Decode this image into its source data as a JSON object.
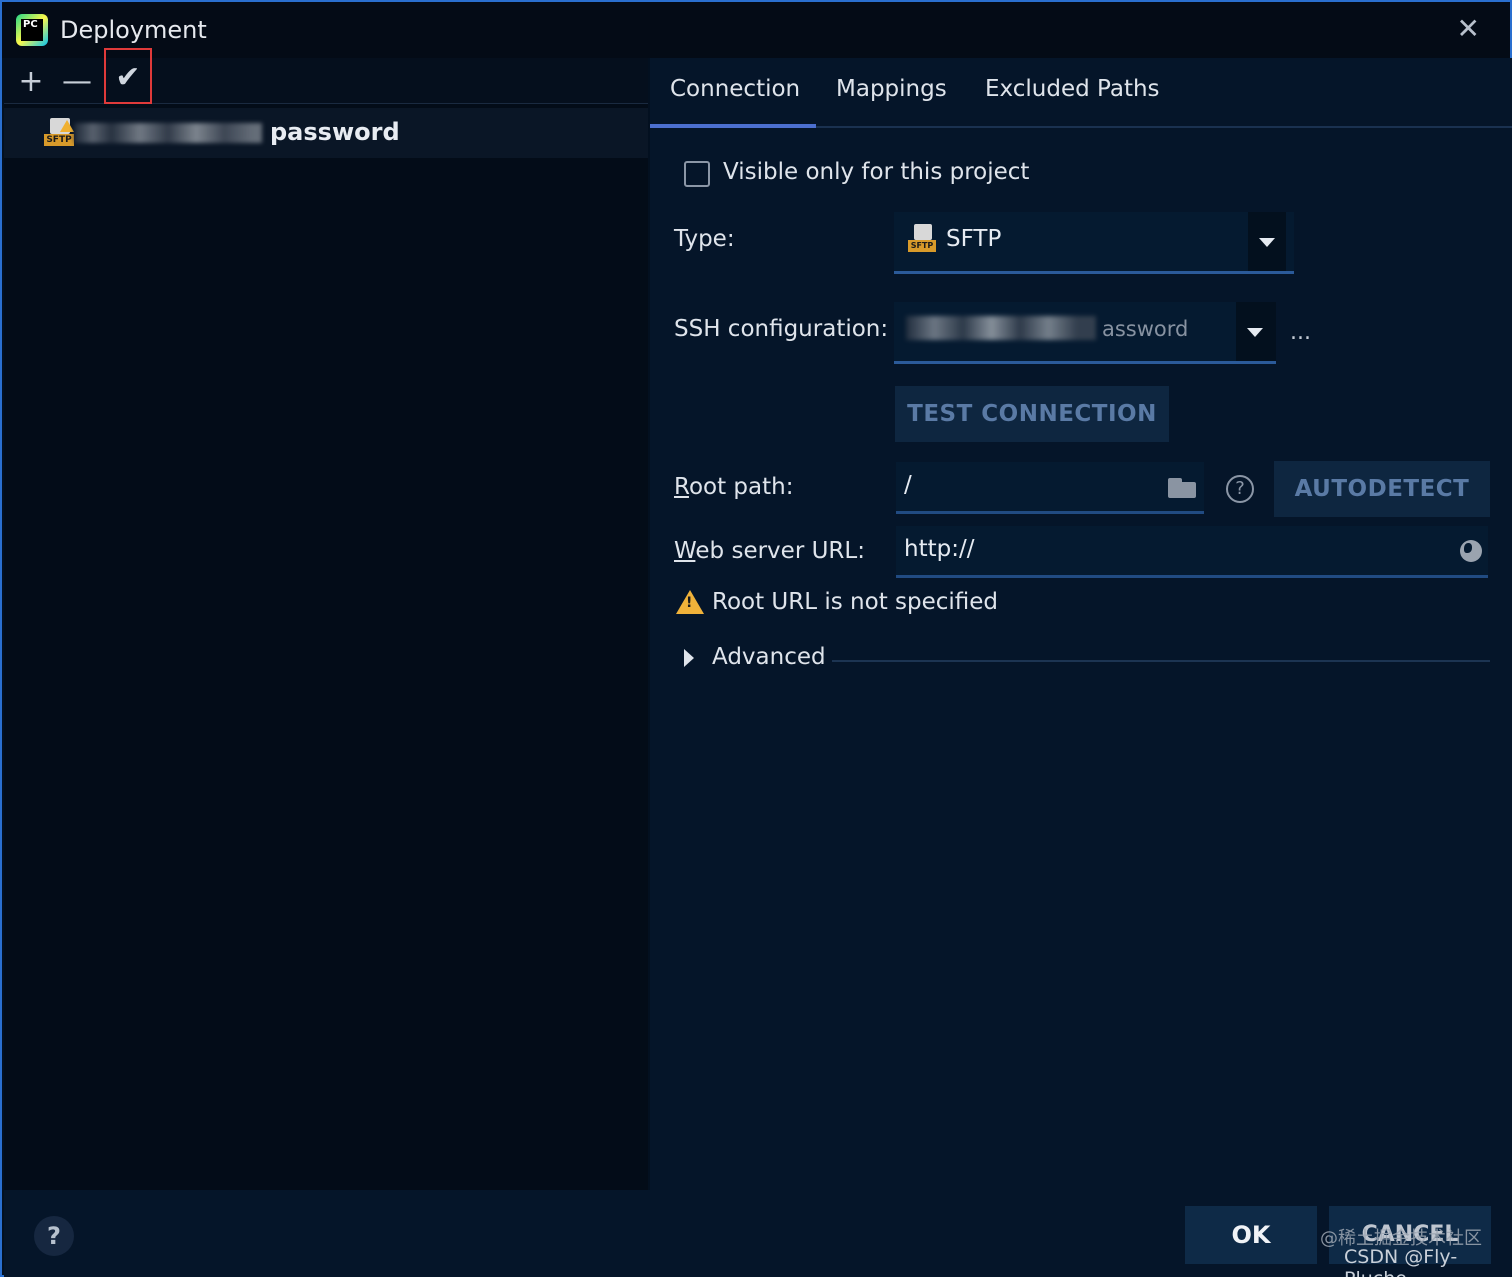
{
  "window": {
    "title": "Deployment",
    "app_icon_text": "PC",
    "close_glyph": "✕"
  },
  "left_toolbar": {
    "add_glyph": "+",
    "remove_glyph": "—",
    "apply_glyph": "✔"
  },
  "server_list": {
    "items": [
      {
        "name": "password",
        "type_label": "SFTP"
      }
    ]
  },
  "tabs": [
    {
      "label": "Connection",
      "active": true
    },
    {
      "label": "Mappings",
      "active": false
    },
    {
      "label": "Excluded Paths",
      "active": false
    }
  ],
  "connection": {
    "visible_only_label": "Visible only for this project",
    "visible_only_checked": false,
    "type_label": "Type:",
    "type_value": "SFTP",
    "type_icon_text": "SFTP",
    "ssh_label": "SSH configuration:",
    "ssh_value_suffix": "assword",
    "ssh_more": "...",
    "test_connection_label": "TEST CONNECTION",
    "root_path_label_first": "R",
    "root_path_label_rest": "oot path:",
    "root_path_value": "/",
    "help_glyph": "?",
    "autodetect_label": "AUTODETECT",
    "web_url_label_first": "W",
    "web_url_label_rest": "eb server URL:",
    "web_url_value": "http://",
    "warning_mark": "!",
    "warning_text": "Root URL is not specified",
    "advanced_label": "Advanced"
  },
  "footer": {
    "help_glyph": "?",
    "ok_label": "OK",
    "cancel_label": "CANCEL",
    "watermark_line1": "@稀土掘金技术社区",
    "watermark_line2": "CSDN @Fly-Pluche"
  },
  "colors": {
    "accent": "#4c6fcf",
    "window_border": "#2a6fcf",
    "warning": "#f0b23a",
    "highlight_box": "#e03a3a"
  }
}
